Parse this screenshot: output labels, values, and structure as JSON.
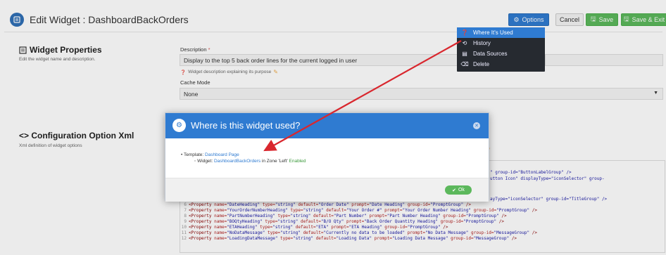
{
  "header": {
    "title": "Edit Widget : DashboardBackOrders",
    "options_label": "Options",
    "cancel_label": "Cancel",
    "save_label": "Save",
    "save_exit_label": "Save & Exit"
  },
  "options_menu": {
    "items": [
      {
        "label": "Where It's Used",
        "icon": "info-icon"
      },
      {
        "label": "History",
        "icon": "history-icon"
      },
      {
        "label": "Data Sources",
        "icon": "database-icon"
      },
      {
        "label": "Delete",
        "icon": "delete-icon"
      }
    ]
  },
  "widget_properties": {
    "title": "Widget Properties",
    "description": "Edit the widget name and description.",
    "description_label": "Description",
    "required_mark": "*",
    "description_value": "Display to the top 5 back order lines for the current logged in user",
    "description_help": "Widget description explaining its purpose",
    "cache_mode_label": "Cache Mode",
    "cache_mode_value": "None"
  },
  "config_xml": {
    "title": "Configuration Option Xml",
    "description": "Xml definition of widget options",
    "partial_lines": [
      {
        "text": "\" group-id=\"ButtonLabelGroup\" />"
      },
      {
        "text": "utton Icon\" displayType=\"iconSelector\" group-"
      },
      {
        "text": "ayType=\"iconSelector\" group-id=\"TitleGroup\" />"
      }
    ],
    "lines": [
      {
        "num": "6",
        "name": "DateHeading",
        "type": "string",
        "default": "Order Date",
        "prompt": "Date Heading",
        "group": "PromptGroup"
      },
      {
        "num": "7",
        "name": "YourOrderNumberHeading",
        "type": "string",
        "default": "Your Order #",
        "prompt": "Your Order Number Heading",
        "group": "PromptGroup"
      },
      {
        "num": "8",
        "name": "PartNumberHeading",
        "type": "string",
        "default": "Part Number",
        "prompt": "Part Number Heading",
        "group": "PromptGroup"
      },
      {
        "num": "9",
        "name": "BOQtyHeading",
        "type": "string",
        "default": "B/O Qty",
        "prompt": "Back Order Quantity Heading",
        "group": "PromptGroup"
      },
      {
        "num": "10",
        "name": "ETAHeading",
        "type": "string",
        "default": "ETA",
        "prompt": "ETA Heading",
        "group": "PromptGroup"
      },
      {
        "num": "11",
        "name": "NoDataMessage",
        "type": "string",
        "default": "Currently no data to be loaded",
        "prompt": "No Data Message",
        "group": "MessageGroup"
      },
      {
        "num": "12",
        "name": "LoadingDataMessage",
        "type": "string",
        "default": "Loading Data",
        "prompt": "Loading Data Message",
        "group": "MessageGroup"
      }
    ]
  },
  "modal": {
    "title": "Where is this widget used?",
    "template_label": "Template:",
    "template_link": "Dashboard Page",
    "widget_label": "Widget:",
    "widget_link": "DashboardBackOrders",
    "zone_text": "in Zone 'Left'",
    "status": "Enabled",
    "ok_label": "Ok"
  },
  "colors": {
    "primary": "#2f7bd1",
    "success": "#5cb85c",
    "dropdown_bg": "#262a30",
    "arrow": "#d9272e"
  }
}
